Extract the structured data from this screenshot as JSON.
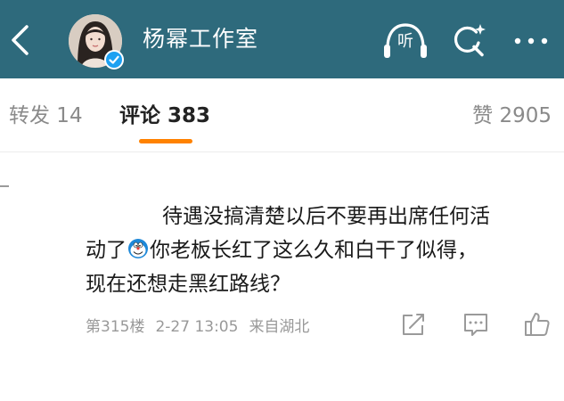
{
  "header": {
    "title": "杨幂工作室",
    "listen_label": "听",
    "background_color": "#2e6a7c",
    "icons": [
      "back-arrow-icon",
      "avatar",
      "verified-icon",
      "headphones-icon",
      "search-icon",
      "more-icon"
    ]
  },
  "tabs": {
    "forward": "转发 14",
    "comment": "评论 383",
    "like": "赞 2905",
    "active_color": "#ff8200"
  },
  "comment": {
    "line1": "待遇没搞清楚以后不要再出席任何活",
    "line2_before": "动了",
    "line2_after": "你老板长红了这么久和白干了似得，",
    "line3": "现在还想走黑红路线？",
    "emoji_icon": "doraemon-emoji-icon",
    "floor": "第315楼",
    "time": "2-27 13:05",
    "source": "来自湖北",
    "action_icons": [
      "share-icon",
      "comment-icon",
      "thumbs-up-icon"
    ]
  }
}
